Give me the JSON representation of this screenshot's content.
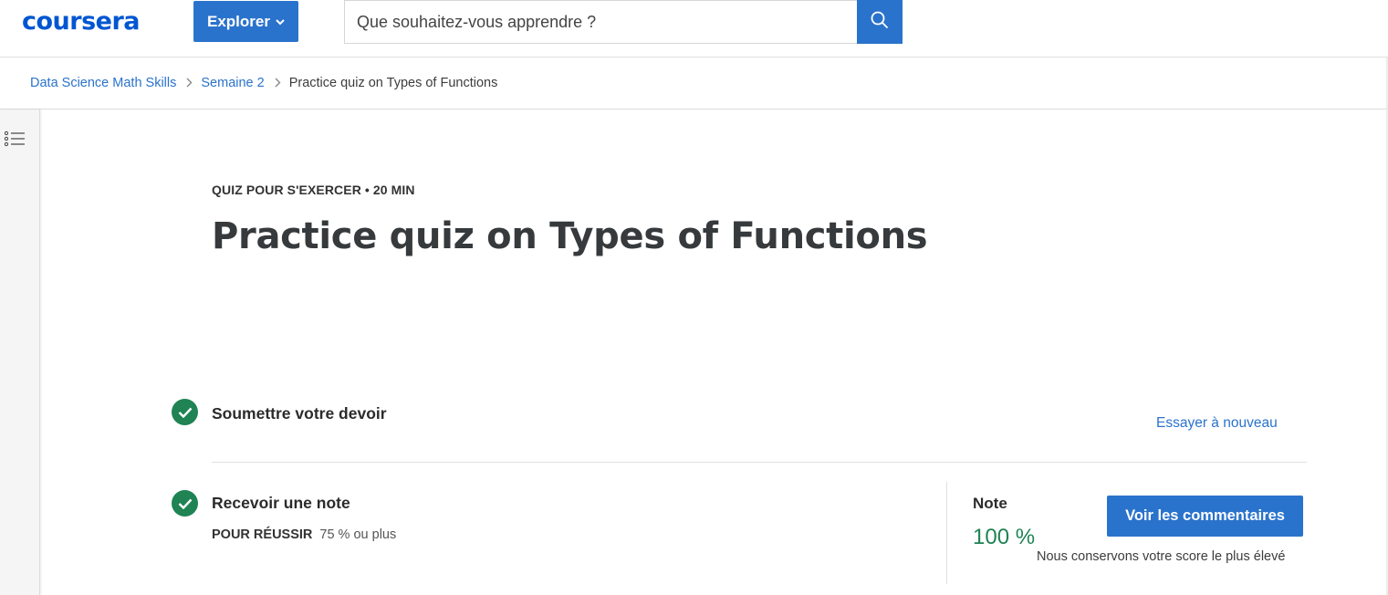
{
  "header": {
    "logo": "coursera",
    "explore_label": "Explorer",
    "search_placeholder": "Que souhaitez-vous apprendre ?",
    "search_icon": "search-icon"
  },
  "breadcrumb": {
    "items": [
      "Data Science Math Skills",
      "Semaine 2"
    ],
    "current": "Practice quiz on Types of Functions"
  },
  "rail": {
    "toggle_icon": "list-icon"
  },
  "quiz": {
    "meta": "QUIZ POUR S'EXERCER • 20  MIN",
    "title": "Practice quiz on Types of Functions"
  },
  "steps": {
    "submit": {
      "title": "Soumettre votre devoir",
      "retry_label": "Essayer à nouveau"
    },
    "grade": {
      "title": "Recevoir une note",
      "pass_label": "POUR RÉUSSIR",
      "pass_value": "75 % ou plus",
      "grade_label": "Note",
      "grade_value": "100 %",
      "feedback_button": "Voir les commentaires",
      "keep_note": "Nous conservons votre score le plus élevé"
    }
  },
  "colors": {
    "brand": "#0056d2",
    "accent": "#2a73cc",
    "success": "#1f8354"
  }
}
